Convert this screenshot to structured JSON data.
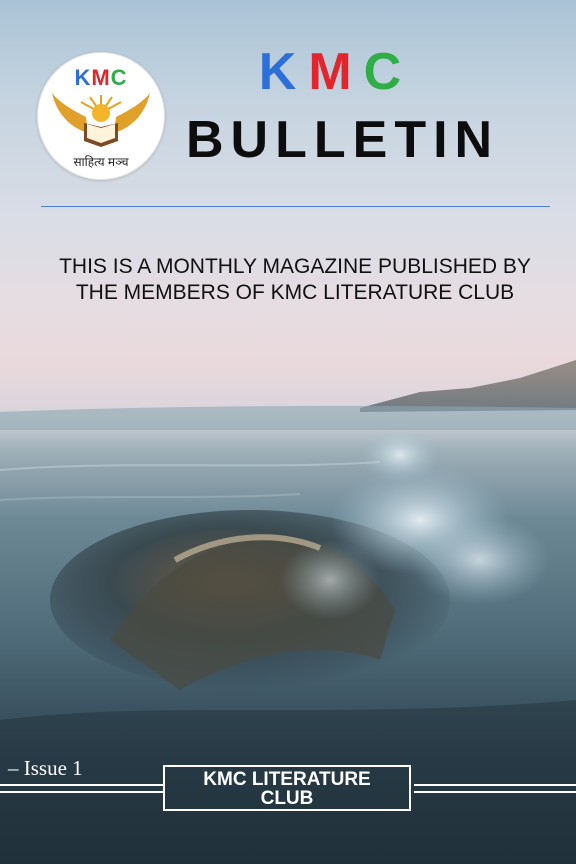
{
  "logo": {
    "letters": [
      "K",
      "M",
      "C"
    ],
    "subtitle": "साहित्य मञ्च",
    "colors": {
      "k": "#2d6fd8",
      "m": "#e3262e",
      "c": "#2fae45"
    }
  },
  "masthead": {
    "letters": [
      "K",
      "M",
      "C"
    ],
    "title": "BULLETIN"
  },
  "tagline": "THIS IS A MONTHLY MAGAZINE PUBLISHED BY THE MEMBERS OF KMC LITERATURE CLUB",
  "footer": {
    "issue": "– Issue 1",
    "club_line1": "KMC LITERATURE",
    "club_line2": "CLUB"
  }
}
